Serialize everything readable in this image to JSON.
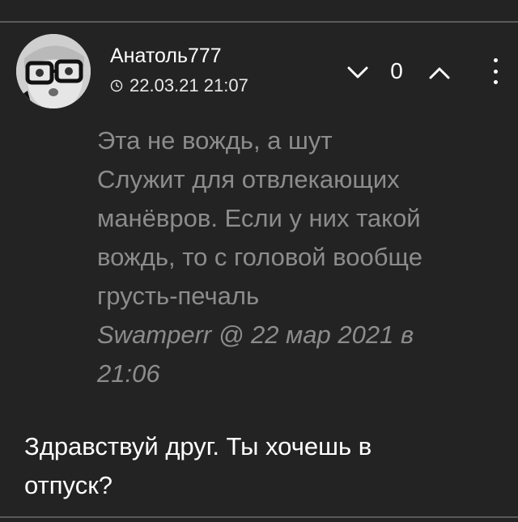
{
  "comment": {
    "author": "Анатоль777",
    "timestamp": "22.03.21 21:07",
    "rating": "0",
    "quote": {
      "lines": [
        "Эта не вождь, а шут",
        "Служит для отвлекающих",
        "манёвров. Если у них такой",
        "вождь, то с головой вообще",
        "грусть-печаль"
      ],
      "cite_author": "Swamperr",
      "cite_rest": " @ 22 мар 2021 в",
      "cite_time": "21:06"
    },
    "reply_lines": [
      "Здравствуй друг. Ты хочешь в",
      "отпуск?"
    ]
  },
  "icons": {
    "clock": "clock-icon",
    "vote_down": "chevron-down-icon",
    "vote_up": "chevron-up-icon",
    "more": "more-vertical-icon"
  },
  "colors": {
    "background": "#232323",
    "text": "#ffffff",
    "quote_text": "#8c8c8c",
    "divider": "#5a5a5a"
  }
}
